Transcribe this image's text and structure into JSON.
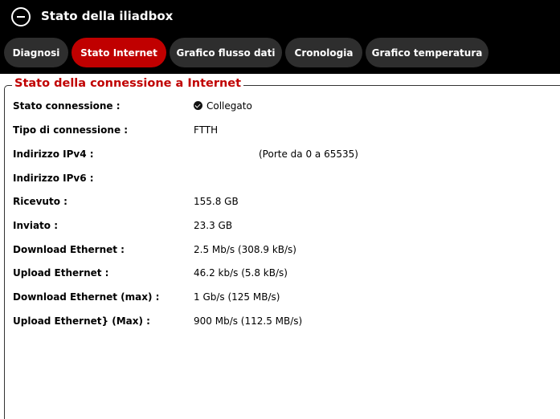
{
  "app": {
    "title": "Stato della iliadbox"
  },
  "tabs": [
    {
      "label": "Diagnosi",
      "active": false
    },
    {
      "label": "Stato Internet",
      "active": true
    },
    {
      "label": "Grafico flusso dati",
      "active": false
    },
    {
      "label": "Cronologia",
      "active": false
    },
    {
      "label": "Grafico temperatura",
      "active": false
    }
  ],
  "section": {
    "title": "Stato della connessione a Internet"
  },
  "rows": {
    "stato": {
      "label": "Stato connessione :",
      "value": "Collegato"
    },
    "tipo": {
      "label": "Tipo di connessione :",
      "value": "FTTH"
    },
    "ipv4": {
      "label": "Indirizzo IPv4 :",
      "note": "(Porte da 0 a 65535)"
    },
    "ipv6": {
      "label": "Indirizzo IPv6 :"
    },
    "ricevuto": {
      "label": "Ricevuto :",
      "value": "155.8 GB"
    },
    "inviato": {
      "label": "Inviato :",
      "value": "23.3 GB"
    },
    "download": {
      "label": "Download Ethernet :",
      "value": "2.5 Mb/s (308.9 kB/s)"
    },
    "upload": {
      "label": "Upload Ethernet :",
      "value": "46.2 kb/s (5.8 kB/s)"
    },
    "download_max": {
      "label": "Download Ethernet (max) :",
      "value": "1 Gb/s (125 MB/s)"
    },
    "upload_max": {
      "label": "Upload Ethernet} (Max) :",
      "value": "900 Mb/s (112.5 MB/s)"
    }
  },
  "colors": {
    "accent": "#c00000",
    "tab_bg": "#2e2e2e",
    "header_bg": "#000000"
  }
}
